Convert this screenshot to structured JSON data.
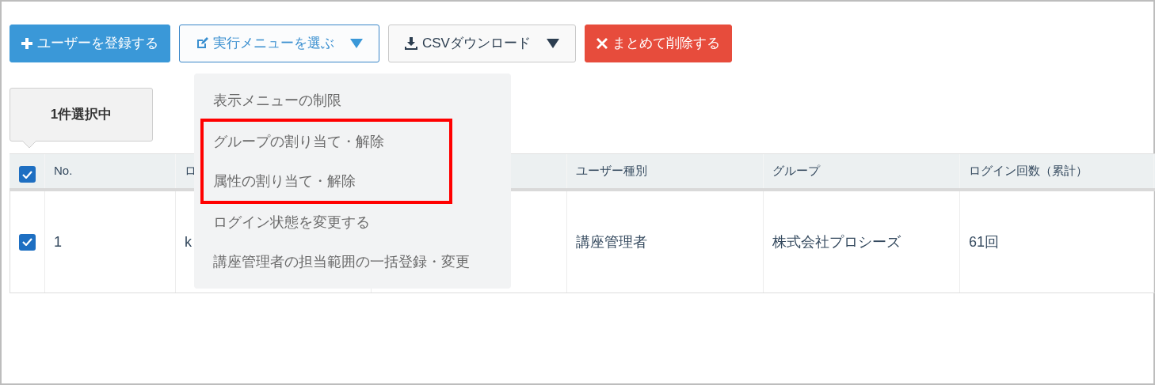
{
  "toolbar": [
    {
      "kind": "primary",
      "label": "ユーザーを登録する",
      "caret": false
    },
    {
      "kind": "outline",
      "label": "実行メニューを選ぶ",
      "caret": true
    },
    {
      "kind": "default",
      "label": "CSVダウンロード",
      "caret": true
    },
    {
      "kind": "danger",
      "label": "まとめて削除する",
      "caret": false
    }
  ],
  "selection_tooltip": "1件選択中",
  "table": {
    "header_checked": true,
    "columns": [
      {
        "label": "No."
      },
      {
        "label": "ロ"
      },
      {},
      {
        "label": "ユーザー種別"
      },
      {
        "label": "グループ"
      },
      {
        "label": "ログイン回数（累計）"
      }
    ],
    "rows": [
      {
        "checked": true,
        "cells": [
          {
            "text": "1"
          },
          {
            "text": "k"
          },
          {},
          {
            "text": "講座管理者"
          },
          {
            "text": "株式会社プロシーズ"
          },
          {
            "text": "61回"
          }
        ]
      }
    ]
  },
  "action_menu": {
    "items": [
      {
        "label": "表示メニューの制限",
        "highlighted": false
      },
      {
        "label": "グループの割り当て・解除",
        "highlighted": true
      },
      {
        "label": "属性の割り当て・解除",
        "highlighted": true
      },
      {
        "label": "ログイン状態を変更する",
        "highlighted": false
      },
      {
        "label": "講座管理者の担当範囲の一括登録・変更",
        "highlighted": false
      }
    ]
  }
}
